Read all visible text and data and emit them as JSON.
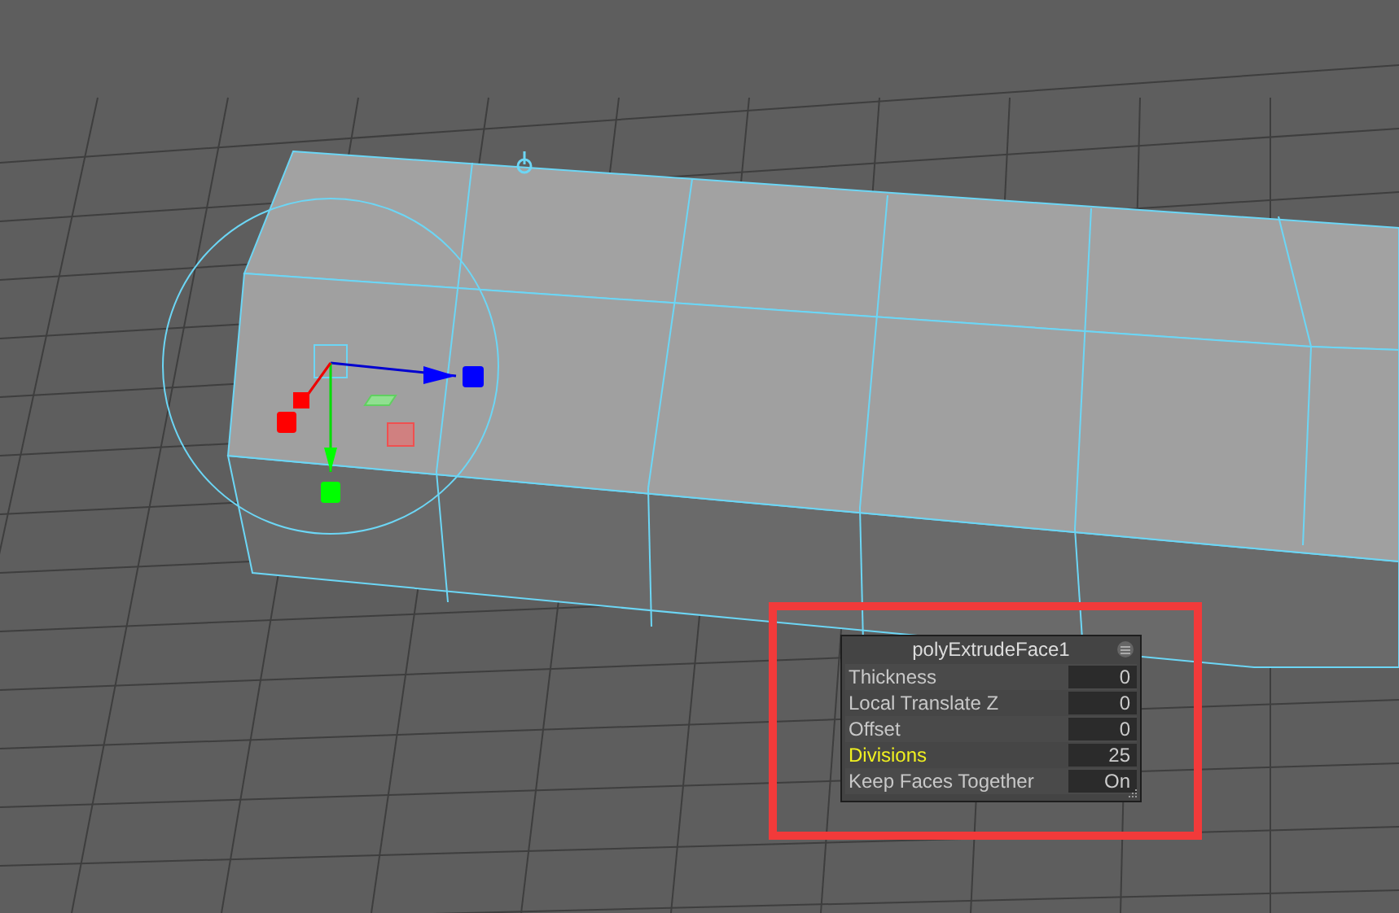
{
  "attribute_panel": {
    "title": "polyExtrudeFace1",
    "rows": [
      {
        "label": "Thickness",
        "value": "0",
        "highlighted": false
      },
      {
        "label": "Local Translate Z",
        "value": "0",
        "highlighted": false
      },
      {
        "label": "Offset",
        "value": "0",
        "highlighted": false
      },
      {
        "label": "Divisions",
        "value": "25",
        "highlighted": true
      },
      {
        "label": "Keep Faces Together",
        "value": "On",
        "highlighted": false
      }
    ]
  }
}
